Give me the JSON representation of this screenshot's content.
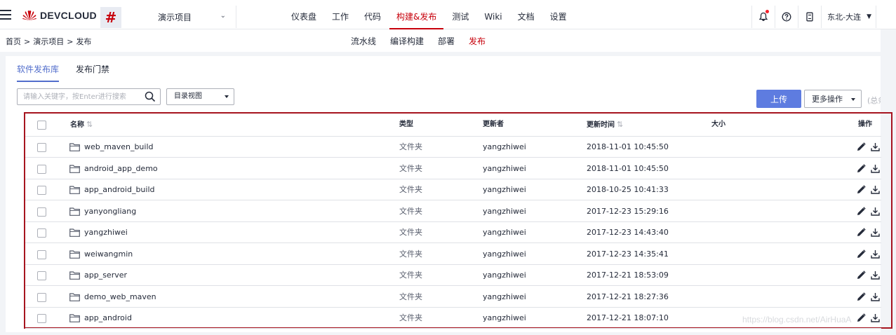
{
  "header": {
    "logo_text": "DEVCLOUD",
    "project_hash": "#",
    "project_name": "演示项目",
    "nav": [
      {
        "label": "仪表盘",
        "active": false
      },
      {
        "label": "工作",
        "active": false
      },
      {
        "label": "代码",
        "active": false
      },
      {
        "label": "构建&发布",
        "active": true
      },
      {
        "label": "测试",
        "active": false
      },
      {
        "label": "Wiki",
        "active": false
      },
      {
        "label": "文档",
        "active": false
      },
      {
        "label": "设置",
        "active": false
      }
    ],
    "region": "东北-大连"
  },
  "breadcrumb": [
    "首页",
    "演示项目",
    "发布"
  ],
  "subnav": [
    {
      "label": "流水线",
      "active": false
    },
    {
      "label": "编译构建",
      "active": false
    },
    {
      "label": "部署",
      "active": false
    },
    {
      "label": "发布",
      "active": true
    }
  ],
  "tabs": [
    {
      "label": "软件发布库",
      "active": true
    },
    {
      "label": "发布门禁",
      "active": false
    }
  ],
  "toolbar": {
    "search_placeholder": "请输入关键字，按Enter进行搜索",
    "view_select": "目录视图",
    "upload_label": "上传",
    "more_label": "更多操作",
    "total_label": "(总条"
  },
  "table": {
    "columns": {
      "name": "名称",
      "type": "类型",
      "updater": "更新者",
      "updated_at": "更新时间",
      "size": "大小",
      "ops": "操作"
    },
    "rows": [
      {
        "name": "web_maven_build",
        "type": "文件夹",
        "updater": "yangzhiwei",
        "updated_at": "2018-11-01 10:45:50"
      },
      {
        "name": "android_app_demo",
        "type": "文件夹",
        "updater": "yangzhiwei",
        "updated_at": "2018-11-01 10:45:50"
      },
      {
        "name": "app_android_build",
        "type": "文件夹",
        "updater": "yangzhiwei",
        "updated_at": "2018-10-25 10:41:33"
      },
      {
        "name": "yanyongliang",
        "type": "文件夹",
        "updater": "yangzhiwei",
        "updated_at": "2017-12-23 15:29:16"
      },
      {
        "name": "yangzhiwei",
        "type": "文件夹",
        "updater": "yangzhiwei",
        "updated_at": "2017-12-23 14:43:40"
      },
      {
        "name": "weiwangmin",
        "type": "文件夹",
        "updater": "yangzhiwei",
        "updated_at": "2017-12-23 14:35:41"
      },
      {
        "name": "app_server",
        "type": "文件夹",
        "updater": "yangzhiwei",
        "updated_at": "2017-12-21 18:53:09"
      },
      {
        "name": "demo_web_maven",
        "type": "文件夹",
        "updater": "yangzhiwei",
        "updated_at": "2017-12-21 18:27:36"
      },
      {
        "name": "app_android",
        "type": "文件夹",
        "updater": "yangzhiwei",
        "updated_at": "2017-12-21 18:07:10"
      }
    ]
  },
  "watermark": "https://blog.csdn.net/AirHuaA",
  "colors": {
    "brand_red": "#c7000b",
    "primary_blue": "#5e7ce0",
    "highlight_border": "#a6141f"
  },
  "icons": {
    "menu": "hamburger-icon",
    "notify": "bell-icon",
    "help": "question-icon",
    "device": "phone-icon",
    "search": "search-icon",
    "folder": "folder-icon",
    "edit": "pencil-icon",
    "download": "download-icon"
  }
}
